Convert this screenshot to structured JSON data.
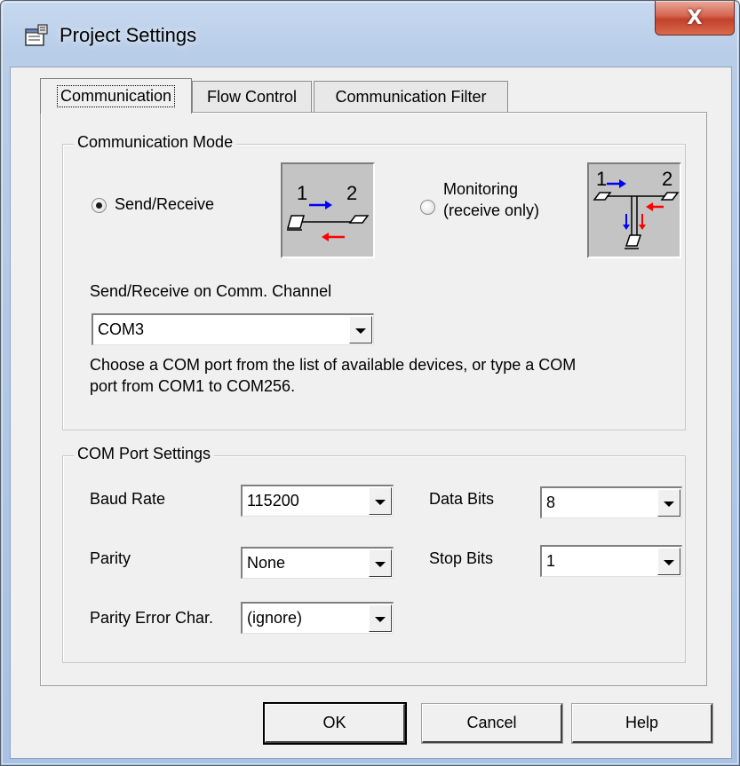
{
  "window": {
    "title": "Project Settings",
    "close_glyph": "X",
    "icon": "settings-sheet-icon"
  },
  "tabs": [
    {
      "label": "Communication",
      "active": true
    },
    {
      "label": "Flow Control",
      "active": false
    },
    {
      "label": "Communication Filter",
      "active": false
    }
  ],
  "comm_mode": {
    "group_title": "Communication Mode",
    "send_receive_label": "Send/Receive",
    "send_receive_selected": true,
    "monitoring_label_line1": "Monitoring",
    "monitoring_label_line2": "(receive only)",
    "monitoring_selected": false,
    "diagram_label_1": "1",
    "diagram_label_2": "2",
    "channel_label": "Send/Receive on Comm. Channel",
    "channel_value": "COM3",
    "hint_line1": "Choose a COM port from the list of available devices, or type a COM",
    "hint_line2": "port from COM1 to COM256.",
    "arrow_colors": {
      "send": "#0000ff",
      "receive": "#ff0000"
    }
  },
  "port_settings": {
    "group_title": "COM Port Settings",
    "baud_rate_label": "Baud Rate",
    "baud_rate_value": "115200",
    "data_bits_label": "Data Bits",
    "data_bits_value": "8",
    "parity_label": "Parity",
    "parity_value": "None",
    "stop_bits_label": "Stop Bits",
    "stop_bits_value": "1",
    "parity_error_label": "Parity Error Char.",
    "parity_error_value": "(ignore)"
  },
  "buttons": {
    "ok": "OK",
    "cancel": "Cancel",
    "help": "Help"
  }
}
